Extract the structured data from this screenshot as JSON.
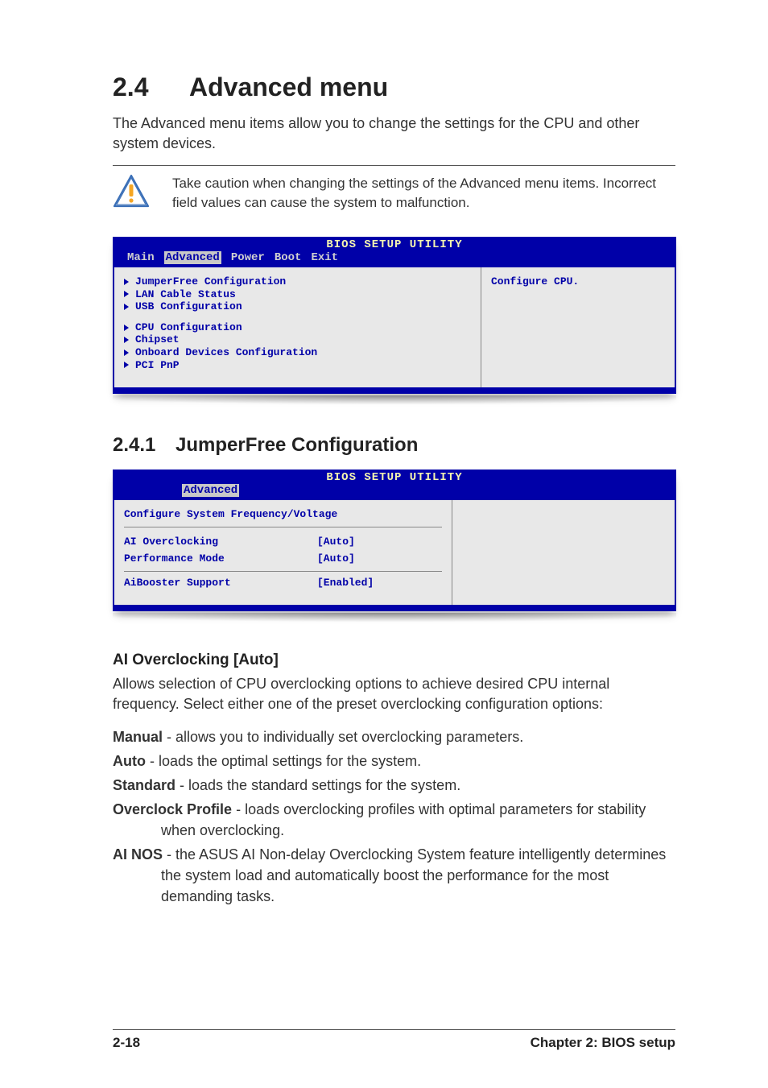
{
  "section": {
    "num": "2.4",
    "title": "Advanced menu"
  },
  "intro": "The Advanced menu items allow you to change the settings for the CPU and other system devices.",
  "caution": "Take caution when changing the settings of the Advanced menu items. Incorrect field values can cause the system to malfunction.",
  "bios1": {
    "title": "BIOS SETUP UTILITY",
    "tabs": {
      "main": "Main",
      "advanced": "Advanced",
      "power": "Power",
      "boot": "Boot",
      "exit": "Exit"
    },
    "group1": [
      "JumperFree Configuration",
      "LAN Cable Status",
      "USB Configuration"
    ],
    "group2": [
      "CPU Configuration",
      "Chipset",
      "Onboard Devices Configuration",
      "PCI PnP"
    ],
    "help": "Configure CPU."
  },
  "sub": {
    "num": "2.4.1",
    "title": "JumperFree Configuration"
  },
  "bios2": {
    "title": "BIOS SETUP UTILITY",
    "tab": "Advanced",
    "section_title": "Configure System Frequency/Voltage",
    "rows": [
      {
        "label": "AI Overclocking",
        "val": "[Auto]"
      },
      {
        "label": "Performance Mode",
        "val": "[Auto]"
      },
      {
        "label": "AiBooster Support",
        "val": "[Enabled]"
      }
    ]
  },
  "h3": "AI Overclocking [Auto]",
  "h3_body": "Allows selection of CPU overclocking options to achieve desired CPU internal frequency. Select either one of the preset overclocking configuration options:",
  "options": [
    {
      "name": "Manual",
      "desc": " - allows you to individually set overclocking parameters."
    },
    {
      "name": "Auto",
      "desc": " - loads the optimal settings for the system."
    },
    {
      "name": "Standard",
      "desc": " - loads the standard settings for the system."
    },
    {
      "name": "Overclock Profile",
      "desc": " - loads overclocking profiles with optimal parameters for stability when overclocking."
    },
    {
      "name": "AI NOS",
      "desc": " - the ASUS AI Non-delay Overclocking System feature intelligently determines the system load and automatically boost the performance for the most demanding tasks."
    }
  ],
  "footer": {
    "page": "2-18",
    "chapter": "Chapter 2: BIOS setup"
  }
}
